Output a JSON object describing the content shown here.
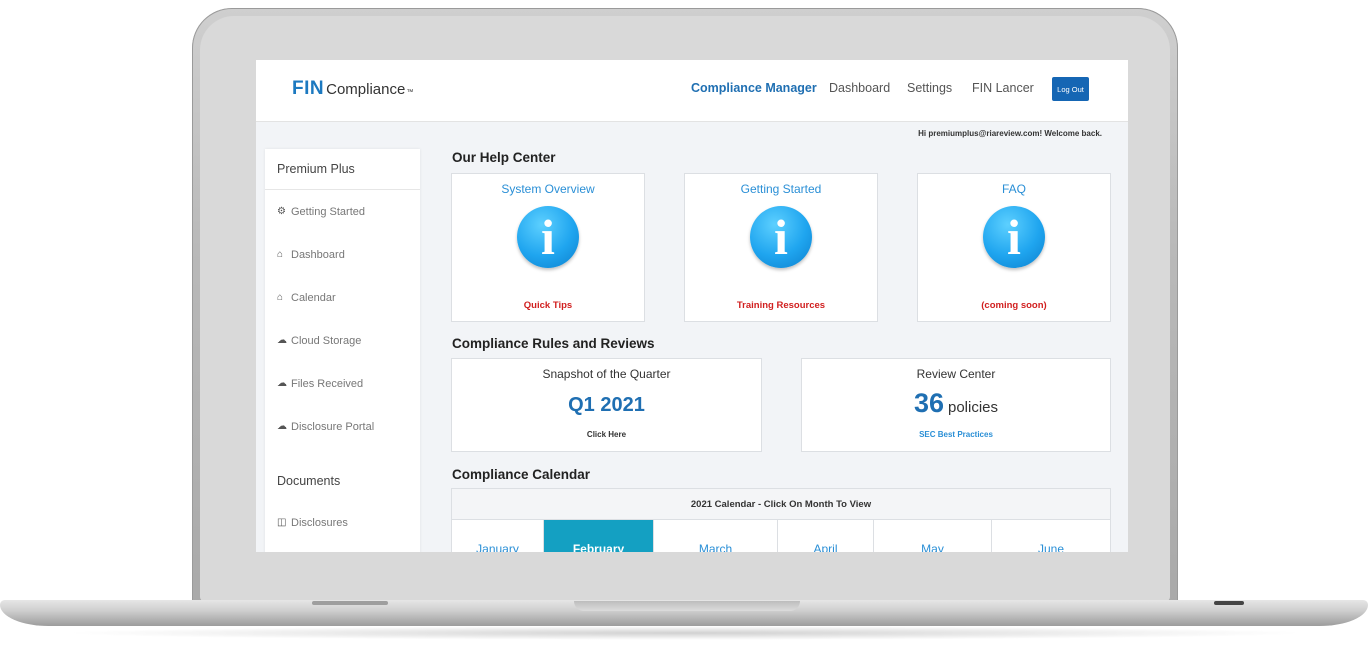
{
  "header": {
    "logo_fin": "FIN",
    "logo_compliance": "Compliance",
    "logo_tm": "™",
    "nav": [
      {
        "label": "Compliance Manager",
        "active": true
      },
      {
        "label": "Dashboard",
        "active": false
      },
      {
        "label": "Settings",
        "active": false
      },
      {
        "label": "FIN Lancer",
        "active": false
      }
    ],
    "logout_label": "Log Out"
  },
  "welcome_text": "Hi premiumplus@riareview.com! Welcome back.",
  "sidebar": {
    "section1_title": "Premium Plus",
    "items": [
      {
        "icon": "gear-icon",
        "glyph": "⚙",
        "label": "Getting Started"
      },
      {
        "icon": "home-icon",
        "glyph": "⌂",
        "label": "Dashboard"
      },
      {
        "icon": "home-icon",
        "glyph": "⌂",
        "label": "Calendar"
      },
      {
        "icon": "cloud-icon",
        "glyph": "☁",
        "label": "Cloud Storage"
      },
      {
        "icon": "cloud-icon",
        "glyph": "☁",
        "label": "Files Received"
      },
      {
        "icon": "cloud-icon",
        "glyph": "☁",
        "label": "Disclosure Portal"
      }
    ],
    "section2_title": "Documents",
    "doc_items": [
      {
        "icon": "columns-icon",
        "glyph": "◫",
        "label": "Disclosures"
      }
    ]
  },
  "help_center": {
    "title": "Our Help Center",
    "cards": [
      {
        "title": "System Overview",
        "icon": "info-icon",
        "glyph": "i",
        "subtitle": "Quick Tips"
      },
      {
        "title": "Getting Started",
        "icon": "info-icon",
        "glyph": "i",
        "subtitle": "Training Resources"
      },
      {
        "title": "FAQ",
        "icon": "info-icon",
        "glyph": "i",
        "subtitle": "(coming soon)"
      }
    ]
  },
  "rules": {
    "title": "Compliance Rules and Reviews",
    "snapshot": {
      "title": "Snapshot of the Quarter",
      "value": "Q1 2021",
      "link": "Click Here"
    },
    "review": {
      "title": "Review Center",
      "count": "36",
      "unit": "policies",
      "link": "SEC Best Practices"
    }
  },
  "calendar": {
    "title": "Compliance Calendar",
    "header": "2021 Calendar - Click On Month To View",
    "months": [
      "January",
      "February",
      "March",
      "April",
      "May",
      "June"
    ],
    "selected": "February"
  },
  "colors": {
    "brand_blue": "#1f6fb2",
    "link_blue": "#2a8fd6",
    "logout_blue": "#1566b4",
    "alert_red": "#d11f1f",
    "month_selected": "#14a0c2"
  }
}
